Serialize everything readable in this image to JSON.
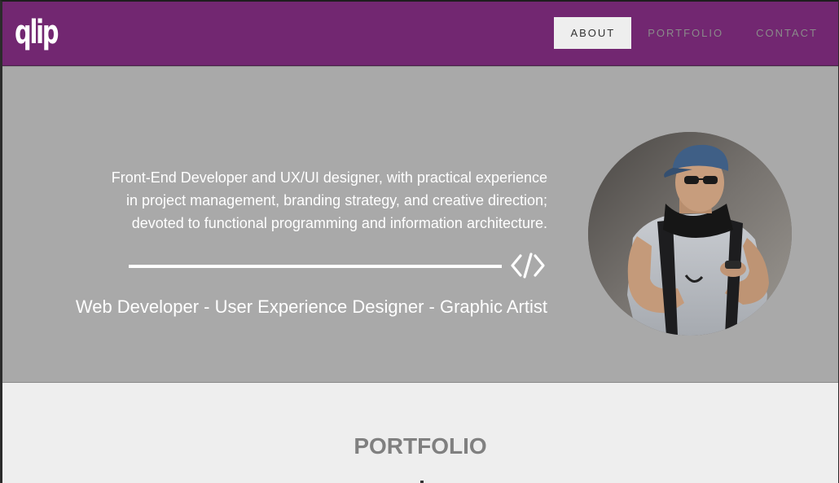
{
  "brand": {
    "logo_text": "qlip",
    "accent_color": "#722771"
  },
  "nav": {
    "items": [
      {
        "label": "ABOUT",
        "active": true
      },
      {
        "label": "PORTFOLIO",
        "active": false
      },
      {
        "label": "CONTACT",
        "active": false
      }
    ]
  },
  "hero": {
    "bio_lines": [
      "Front-End Developer and UX/UI designer, with practical experience",
      "in project management, branding strategy, and creative direction;",
      "devoted to functional programming and information architecture."
    ],
    "divider_icon": "code-icon",
    "tagline": "Web Developer - User Experience Designer - Graphic Artist",
    "avatar_icon": "profile-photo"
  },
  "portfolio": {
    "title": "PORTFOLIO"
  }
}
